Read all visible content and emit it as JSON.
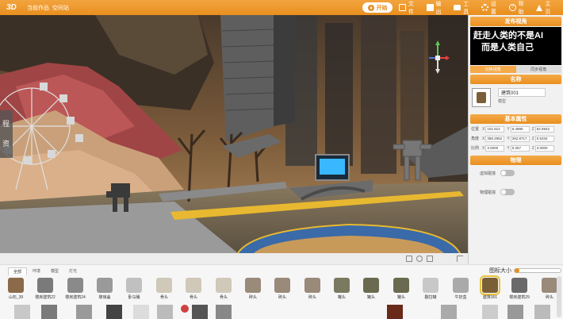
{
  "app": {
    "logo": "3D",
    "crumb_works": "当前作品",
    "crumb_name": "空间站"
  },
  "toolbar": {
    "start_label": "开始",
    "menu": [
      {
        "label": "文件",
        "icon": "file-icon"
      },
      {
        "label": "输出",
        "icon": "export-icon"
      },
      {
        "label": "工具",
        "icon": "tools-icon"
      },
      {
        "label": "设置",
        "icon": "gear-icon"
      },
      {
        "label": "帮助",
        "icon": "help-icon"
      },
      {
        "label": "主页",
        "icon": "home-icon"
      }
    ]
  },
  "panel": {
    "publish_view": {
      "title": "发布视角",
      "preview_line1": "赶走人类的不是AI",
      "preview_line2": "而是人类自己",
      "tab_switch": "切换视角",
      "tab_sync": "同步视角"
    },
    "name_section": {
      "title": "名称",
      "name_value": "建筑001",
      "type_label": "模型"
    },
    "props_section": {
      "title": "基本属性",
      "rows": [
        {
          "label": "位置",
          "x": "101.812",
          "y": "6.4896",
          "z": "62.5942"
        },
        {
          "label": "角度",
          "x": "358.2952",
          "y": "262.8717",
          "z": "0.5334"
        },
        {
          "label": "比例",
          "x": "3.0000",
          "y": "5.357",
          "z": "3.0000"
        }
      ],
      "axis_x": "X",
      "axis_y": "Y",
      "axis_z": "Z"
    },
    "physics_section": {
      "title": "物理",
      "virtual_collision": "虚拟碰撞",
      "physics_collision": "物理碰撞"
    }
  },
  "library": {
    "tabs": [
      "全部",
      "环境",
      "模型",
      "灯光"
    ],
    "active_tab": "全部",
    "icon_size_label": "图标大小",
    "icon_size_value": 0.05,
    "assets": [
      "山石_39",
      "楼房建筑22",
      "楼房建筑24",
      "玻璃盖",
      "卧马桶",
      "骨头",
      "骨头",
      "骨头",
      "砖头",
      "砖头",
      "砖头",
      "罐头",
      "罐头",
      "罐头",
      "翻拉罐",
      "牛奶盒",
      "建筑001",
      "楼房建筑29",
      "砖头"
    ],
    "selected_asset": "建筑001"
  },
  "colors": {
    "accent": "#e88f1f",
    "panel_bg": "#f1f1f1",
    "selection": "#e8c23a"
  }
}
